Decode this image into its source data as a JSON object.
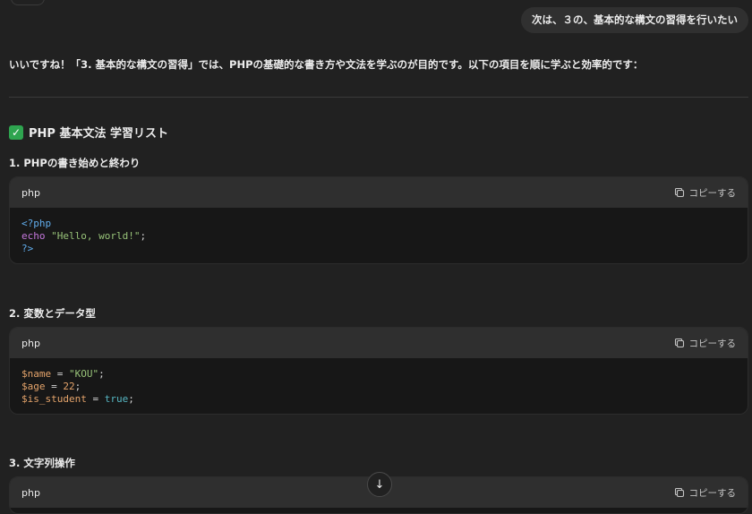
{
  "user_message": "次は、３の、基本的な構文の習得を行いたい",
  "assistant": {
    "intro": "いいですね！「3. 基本的な構文の習得」では、PHPの基礎的な書き方や文法を学ぶのが目的です。以下の項目を順に学ぶと効率的です：",
    "heading_icon": "check-mark-icon",
    "heading_icon_glyph": "✓",
    "heading": "PHP 基本文法 学習リスト",
    "items": [
      {
        "title": "1.  PHPの書き始めと終わり",
        "lang": "php",
        "copy_label": "コピーする",
        "lines": [
          [
            {
              "t": "<?php",
              "c": "tag"
            }
          ],
          [
            {
              "t": "echo",
              "c": "kw"
            },
            {
              "t": " ",
              "c": "plain"
            },
            {
              "t": "\"Hello, world!\"",
              "c": "str"
            },
            {
              "t": ";",
              "c": "plain"
            }
          ],
          [
            {
              "t": "?>",
              "c": "tag"
            }
          ]
        ]
      },
      {
        "title": "2.  変数とデータ型",
        "lang": "php",
        "copy_label": "コピーする",
        "lines": [
          [
            {
              "t": "$name",
              "c": "var"
            },
            {
              "t": " = ",
              "c": "plain"
            },
            {
              "t": "\"KOU\"",
              "c": "str"
            },
            {
              "t": ";",
              "c": "plain"
            }
          ],
          [
            {
              "t": "$age",
              "c": "var"
            },
            {
              "t": " = ",
              "c": "plain"
            },
            {
              "t": "22",
              "c": "num"
            },
            {
              "t": ";",
              "c": "plain"
            }
          ],
          [
            {
              "t": "$is_student",
              "c": "var"
            },
            {
              "t": " = ",
              "c": "plain"
            },
            {
              "t": "true",
              "c": "lit"
            },
            {
              "t": ";",
              "c": "plain"
            }
          ]
        ]
      },
      {
        "title": "3.  文字列操作",
        "lang": "php",
        "copy_label": "コピーする",
        "lines": []
      }
    ]
  },
  "scroll_down_icon": "arrow-down-icon",
  "scroll_down_glyph": "↓"
}
